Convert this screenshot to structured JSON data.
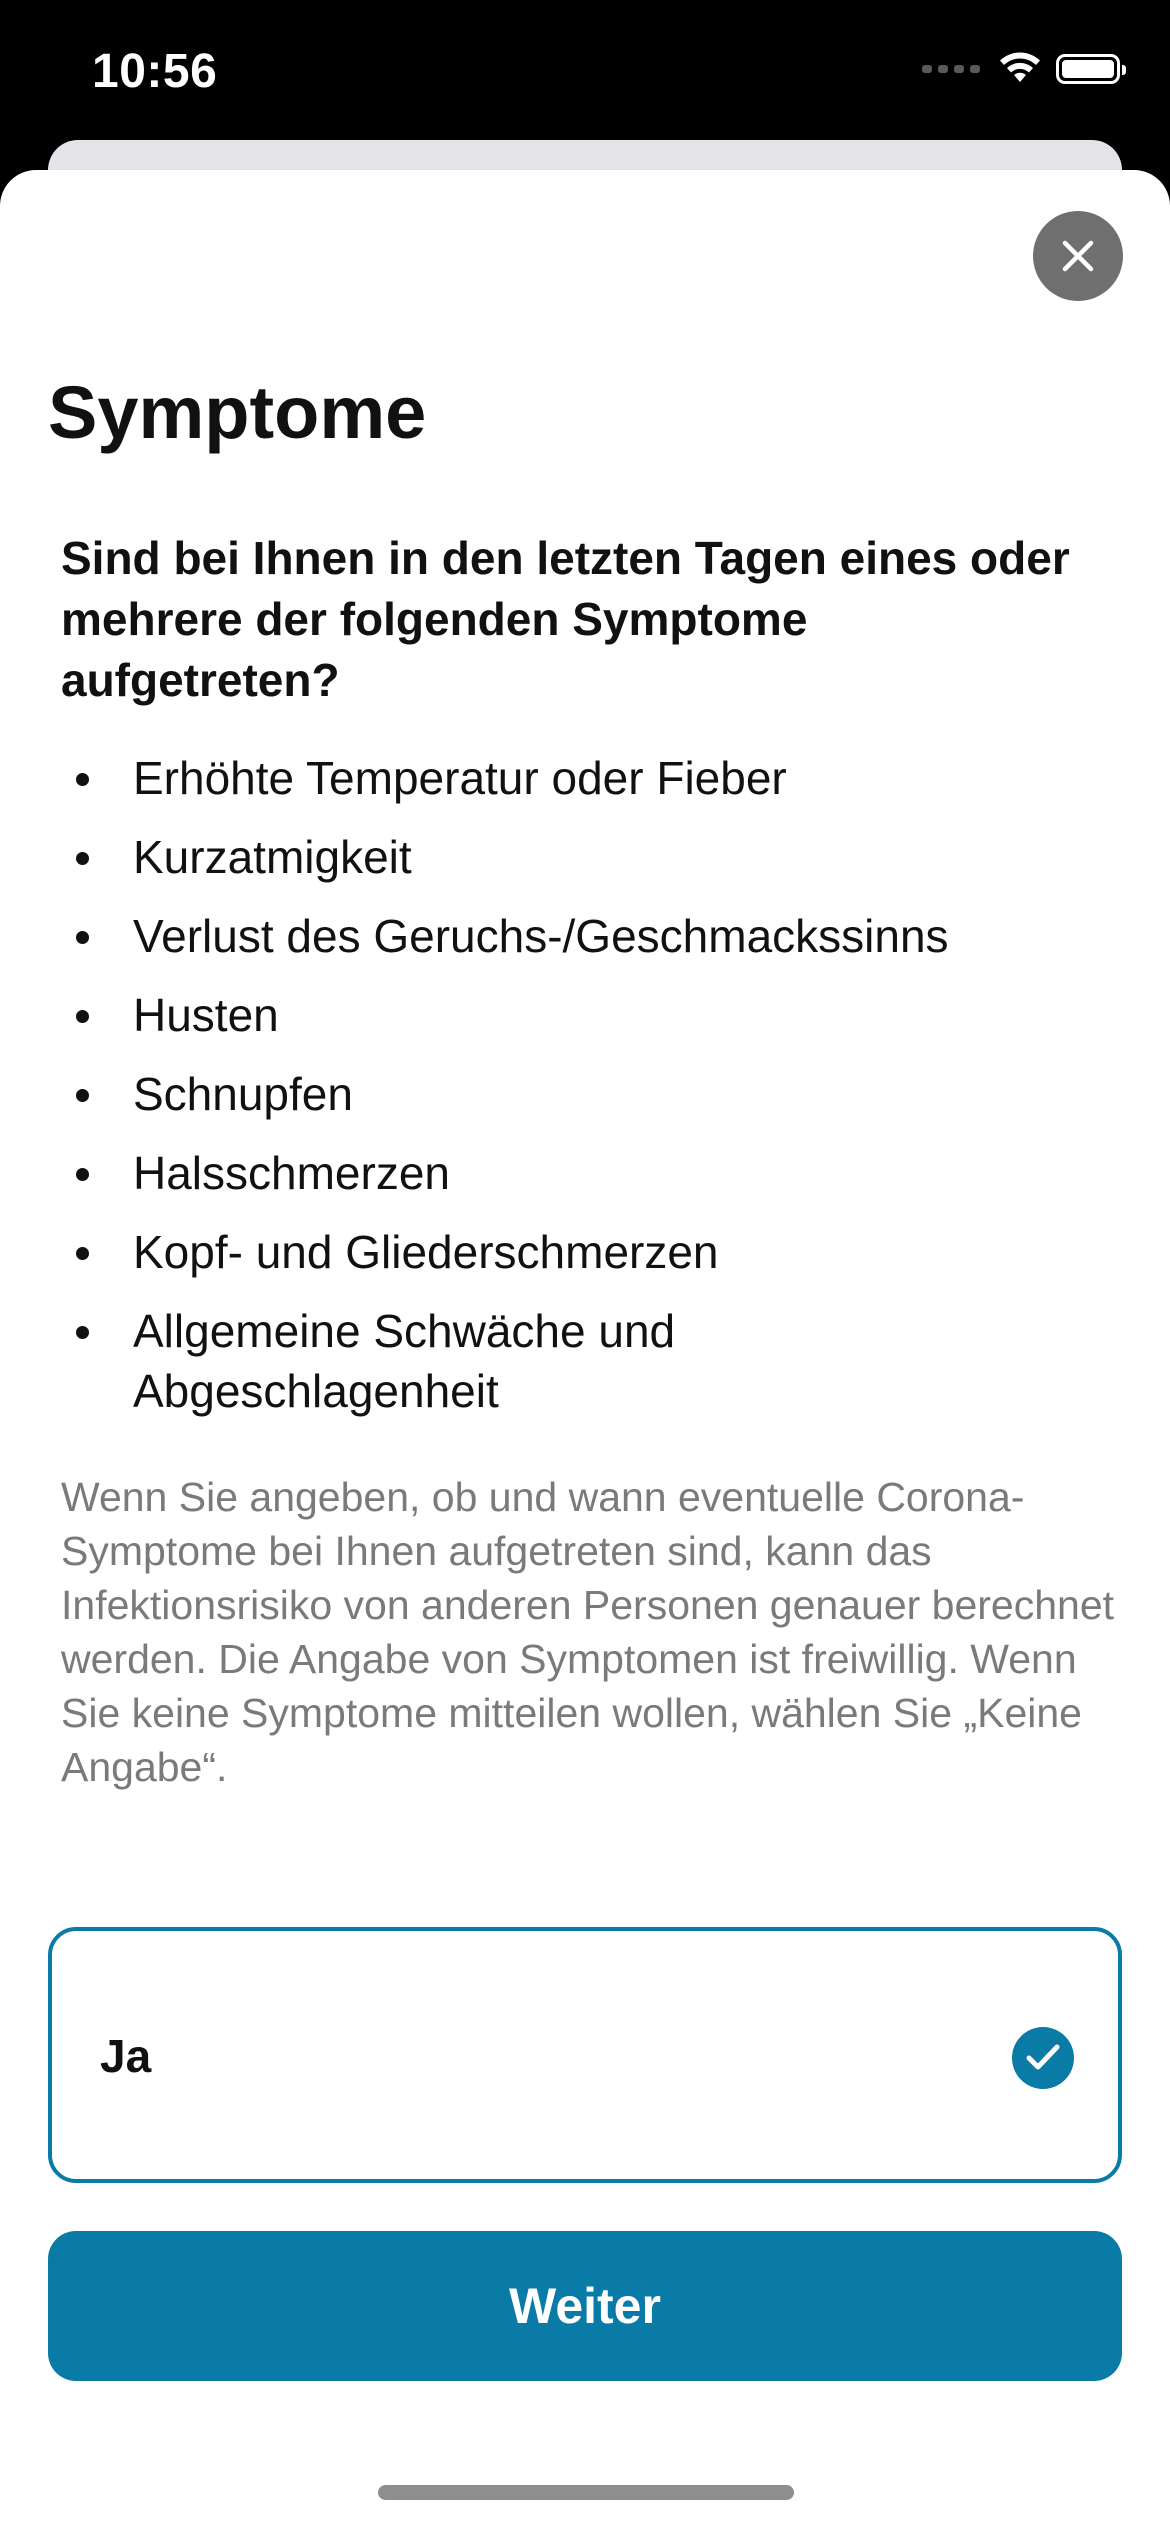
{
  "status_bar": {
    "time": "10:56",
    "icons": [
      "cellular-icon",
      "wifi-icon",
      "battery-icon"
    ]
  },
  "sheet": {
    "close_icon": "close-icon",
    "title": "Symptome",
    "question": "Sind bei Ihnen in den letzten Tagen eines oder mehrere der folgenden Symptome aufgetreten?",
    "symptoms": [
      "Erhöhte Temperatur oder Fieber",
      "Kurzatmigkeit",
      "Verlust des Geruchs-/Geschmackssinns",
      "Husten",
      "Schnupfen",
      "Halsschmerzen",
      "Kopf- und Gliederschmerzen",
      "Allgemeine Schwäche und Abgeschlagenheit"
    ],
    "info": "Wenn Sie angeben, ob und wann eventuelle Corona-Symptome bei Ihnen aufgetreten sind, kann das Infektionsrisiko von anderen Personen genauer berechnet werden. Die Angabe von Symptomen ist freiwillig. Wenn Sie keine Symptome mitteilen wollen, wählen Sie „Keine Angabe“.",
    "option": {
      "label": "Ja",
      "selected": true
    },
    "continue_label": "Weiter"
  },
  "colors": {
    "accent": "#0a7aa6",
    "close_button": "#6f6f6f",
    "secondary_text": "#7a7a7a"
  }
}
